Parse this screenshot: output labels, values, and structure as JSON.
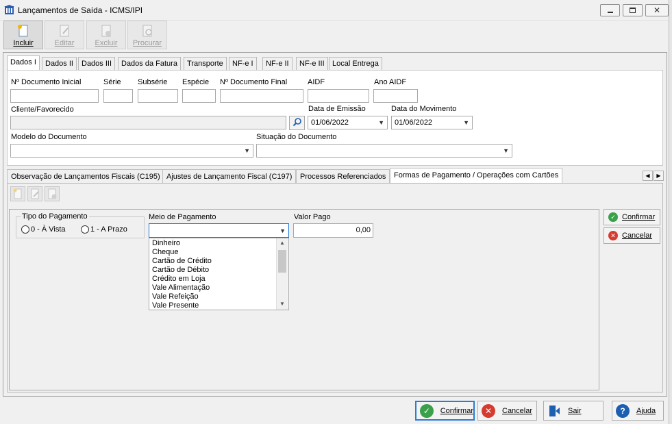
{
  "window": {
    "title": "Lançamentos de Saída - ICMS/IPI"
  },
  "toolbar": {
    "incluir": "Incluir",
    "editar": "Editar",
    "excluir": "Excluir",
    "procurar": "Procurar"
  },
  "tabs_top": [
    "Dados I",
    "Dados II",
    "Dados III",
    "Dados da Fatura",
    "Transporte",
    "NF-e I",
    "NF-e II",
    "NF-e III",
    "Local Entrega"
  ],
  "form": {
    "num_doc_inicial": "Nº Documento Inicial",
    "serie": "Série",
    "subserie": "Subsérie",
    "especie": "Espécie",
    "num_doc_final": "Nº Documento Final",
    "aidf": "AIDF",
    "ano_aidf": "Ano AIDF",
    "cliente": "Cliente/Favorecido",
    "data_emissao": "Data de Emissão",
    "data_emissao_value": "01/06/2022",
    "data_movimento": "Data do Movimento",
    "data_movimento_value": "01/06/2022",
    "modelo": "Modelo do Documento",
    "situacao": "Situação do Documento"
  },
  "tabs_bottom": [
    "Observação de Lançamentos Fiscais (C195)",
    "Ajustes de Lançamento Fiscal (C197)",
    "Processos Referenciados",
    "Formas de Pagamento / Operações com Cartões"
  ],
  "pagamento": {
    "tipo_label": "Tipo do Pagamento",
    "opt_vista": "0 - À Vista",
    "opt_prazo": "1 - A Prazo",
    "meio_label": "Meio de Pagamento",
    "meio_options": [
      "Dinheiro",
      "Cheque",
      "Cartão de Crédito",
      "Cartão de Débito",
      "Crédito em Loja",
      "Vale Alimentação",
      "Vale Refeição",
      "Vale Presente"
    ],
    "valor_label": "Valor Pago",
    "valor_value": "0,00",
    "confirmar": "Confirmar",
    "cancelar": "Cancelar"
  },
  "footer": {
    "confirmar": "Confirmar",
    "cancelar": "Cancelar",
    "sair": "Sair",
    "ajuda": "Ajuda"
  },
  "colors": {
    "confirm_green": "#3aa14a",
    "cancel_red": "#d63b2f",
    "help_blue": "#1c5fb0",
    "arrow_red": "#e02020"
  }
}
